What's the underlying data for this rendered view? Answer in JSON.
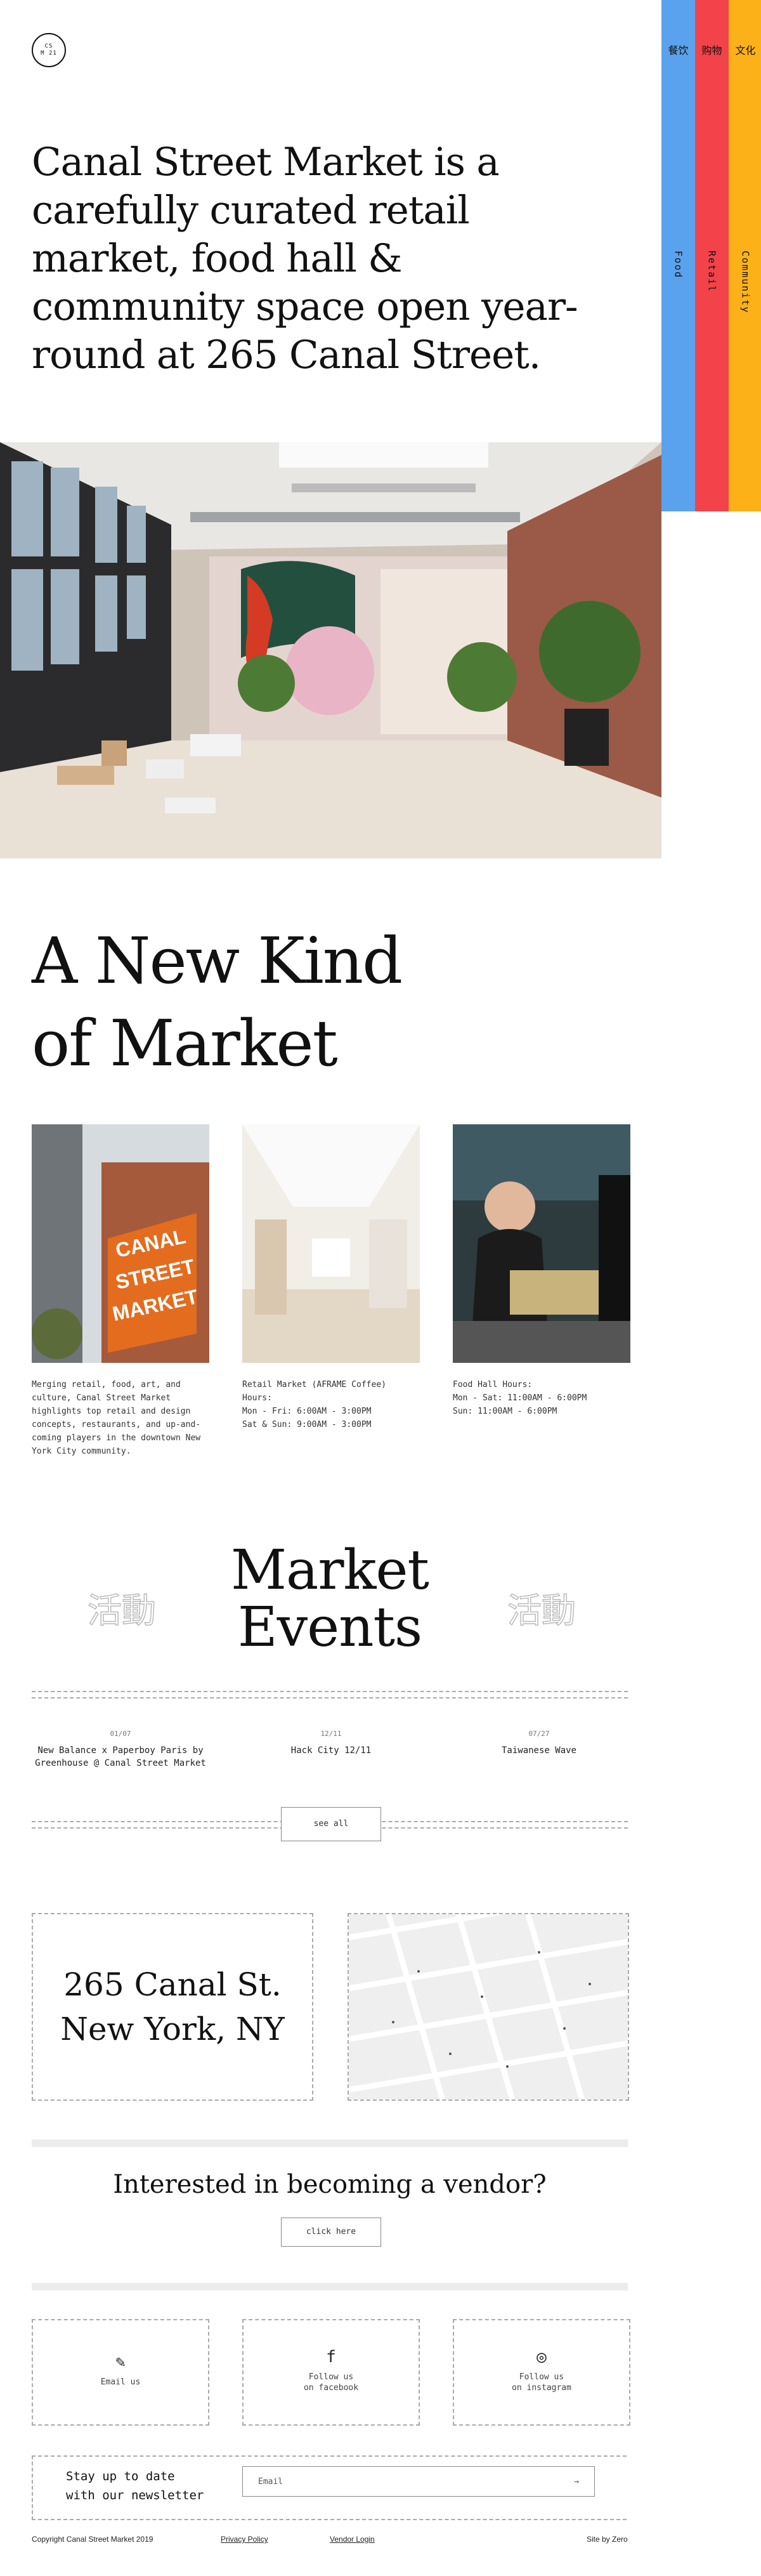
{
  "logo": {
    "line1": "CS",
    "line2": "M 21"
  },
  "strips": [
    {
      "cjk": "餐饮",
      "label": "Food"
    },
    {
      "cjk": "购物",
      "label": "Retail"
    },
    {
      "cjk": "文化",
      "label": "Community"
    }
  ],
  "intro": "Canal Street Market is a carefully curated retail market, food hall & community space open year-round at 265 Canal Street.",
  "new_kind": {
    "line1": "A New Kind",
    "line2": "of Market"
  },
  "cards": [
    {
      "text": "Merging retail, food, art, and culture, Canal Street Market highlights top retail and design concepts, restaurants, and up-and-coming players in the downtown New York City community."
    },
    {
      "line1": "Retail Market (AFRAME Coffee) Hours:",
      "line2": "Mon - Fri: 6:00AM - 3:00PM",
      "line3": "Sat & Sun: 9:00AM - 3:00PM"
    },
    {
      "line1": "Food Hall Hours:",
      "line2": "Mon - Sat: 11:00AM - 6:00PM",
      "line3": "Sun: 11:00AM - 6:00PM"
    }
  ],
  "events": {
    "title1": "Market",
    "title2": "Events",
    "cjk": "活動",
    "items": [
      {
        "date": "01/07",
        "name": "New Balance x Paperboy Paris by Greenhouse @ Canal Street Market"
      },
      {
        "date": "12/11",
        "name": "Hack City 12/11"
      },
      {
        "date": "07/27",
        "name": "Taiwanese Wave"
      }
    ],
    "see_all": "see all"
  },
  "address": {
    "line1": "265 Canal St.",
    "line2": "New York, NY"
  },
  "vendor": {
    "question": "Interested in becoming a vendor?",
    "button": "click here"
  },
  "social": [
    {
      "icon": "pencil-icon",
      "glyph": "✎",
      "label1": "Email us",
      "label2": ""
    },
    {
      "icon": "facebook-icon",
      "glyph": "f",
      "label1": "Follow us",
      "label2": "on facebook"
    },
    {
      "icon": "instagram-icon",
      "glyph": "◎",
      "label1": "Follow us",
      "label2": "on instagram"
    }
  ],
  "newsletter": {
    "label1": "Stay up to date",
    "label2": "with our newsletter",
    "placeholder": "Email",
    "arrow": "→"
  },
  "footer": {
    "copyright": "Copyright Canal Street Market 2019",
    "privacy": "Privacy Policy",
    "vendor_login": "Vendor Login",
    "site_by": "Site by Zero"
  }
}
